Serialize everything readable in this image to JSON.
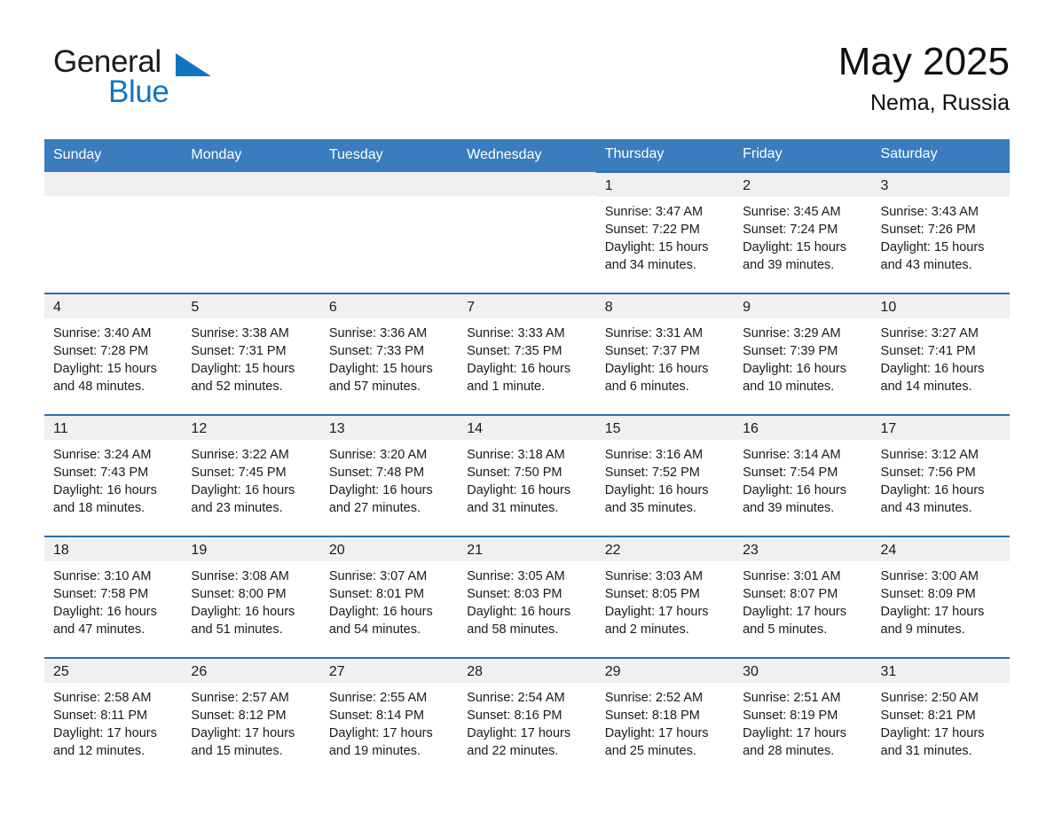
{
  "brand": {
    "word_one": "General",
    "word_two": "Blue",
    "triangle_icon": "triangle-icon"
  },
  "header": {
    "month_title": "May 2025",
    "location": "Nema, Russia"
  },
  "colors": {
    "header_blue": "#3a7cbe",
    "row_rule_blue": "#2f6fad",
    "daynum_gray": "#f0f0f0",
    "brand_blue": "#1275c1"
  },
  "weekday_headers": [
    "Sunday",
    "Monday",
    "Tuesday",
    "Wednesday",
    "Thursday",
    "Friday",
    "Saturday"
  ],
  "weeks": [
    [
      {
        "day": "",
        "sunrise": "",
        "sunset": "",
        "daylight_1": "",
        "daylight_2": ""
      },
      {
        "day": "",
        "sunrise": "",
        "sunset": "",
        "daylight_1": "",
        "daylight_2": ""
      },
      {
        "day": "",
        "sunrise": "",
        "sunset": "",
        "daylight_1": "",
        "daylight_2": ""
      },
      {
        "day": "",
        "sunrise": "",
        "sunset": "",
        "daylight_1": "",
        "daylight_2": ""
      },
      {
        "day": "1",
        "sunrise": "Sunrise: 3:47 AM",
        "sunset": "Sunset: 7:22 PM",
        "daylight_1": "Daylight: 15 hours",
        "daylight_2": "and 34 minutes."
      },
      {
        "day": "2",
        "sunrise": "Sunrise: 3:45 AM",
        "sunset": "Sunset: 7:24 PM",
        "daylight_1": "Daylight: 15 hours",
        "daylight_2": "and 39 minutes."
      },
      {
        "day": "3",
        "sunrise": "Sunrise: 3:43 AM",
        "sunset": "Sunset: 7:26 PM",
        "daylight_1": "Daylight: 15 hours",
        "daylight_2": "and 43 minutes."
      }
    ],
    [
      {
        "day": "4",
        "sunrise": "Sunrise: 3:40 AM",
        "sunset": "Sunset: 7:28 PM",
        "daylight_1": "Daylight: 15 hours",
        "daylight_2": "and 48 minutes."
      },
      {
        "day": "5",
        "sunrise": "Sunrise: 3:38 AM",
        "sunset": "Sunset: 7:31 PM",
        "daylight_1": "Daylight: 15 hours",
        "daylight_2": "and 52 minutes."
      },
      {
        "day": "6",
        "sunrise": "Sunrise: 3:36 AM",
        "sunset": "Sunset: 7:33 PM",
        "daylight_1": "Daylight: 15 hours",
        "daylight_2": "and 57 minutes."
      },
      {
        "day": "7",
        "sunrise": "Sunrise: 3:33 AM",
        "sunset": "Sunset: 7:35 PM",
        "daylight_1": "Daylight: 16 hours",
        "daylight_2": "and 1 minute."
      },
      {
        "day": "8",
        "sunrise": "Sunrise: 3:31 AM",
        "sunset": "Sunset: 7:37 PM",
        "daylight_1": "Daylight: 16 hours",
        "daylight_2": "and 6 minutes."
      },
      {
        "day": "9",
        "sunrise": "Sunrise: 3:29 AM",
        "sunset": "Sunset: 7:39 PM",
        "daylight_1": "Daylight: 16 hours",
        "daylight_2": "and 10 minutes."
      },
      {
        "day": "10",
        "sunrise": "Sunrise: 3:27 AM",
        "sunset": "Sunset: 7:41 PM",
        "daylight_1": "Daylight: 16 hours",
        "daylight_2": "and 14 minutes."
      }
    ],
    [
      {
        "day": "11",
        "sunrise": "Sunrise: 3:24 AM",
        "sunset": "Sunset: 7:43 PM",
        "daylight_1": "Daylight: 16 hours",
        "daylight_2": "and 18 minutes."
      },
      {
        "day": "12",
        "sunrise": "Sunrise: 3:22 AM",
        "sunset": "Sunset: 7:45 PM",
        "daylight_1": "Daylight: 16 hours",
        "daylight_2": "and 23 minutes."
      },
      {
        "day": "13",
        "sunrise": "Sunrise: 3:20 AM",
        "sunset": "Sunset: 7:48 PM",
        "daylight_1": "Daylight: 16 hours",
        "daylight_2": "and 27 minutes."
      },
      {
        "day": "14",
        "sunrise": "Sunrise: 3:18 AM",
        "sunset": "Sunset: 7:50 PM",
        "daylight_1": "Daylight: 16 hours",
        "daylight_2": "and 31 minutes."
      },
      {
        "day": "15",
        "sunrise": "Sunrise: 3:16 AM",
        "sunset": "Sunset: 7:52 PM",
        "daylight_1": "Daylight: 16 hours",
        "daylight_2": "and 35 minutes."
      },
      {
        "day": "16",
        "sunrise": "Sunrise: 3:14 AM",
        "sunset": "Sunset: 7:54 PM",
        "daylight_1": "Daylight: 16 hours",
        "daylight_2": "and 39 minutes."
      },
      {
        "day": "17",
        "sunrise": "Sunrise: 3:12 AM",
        "sunset": "Sunset: 7:56 PM",
        "daylight_1": "Daylight: 16 hours",
        "daylight_2": "and 43 minutes."
      }
    ],
    [
      {
        "day": "18",
        "sunrise": "Sunrise: 3:10 AM",
        "sunset": "Sunset: 7:58 PM",
        "daylight_1": "Daylight: 16 hours",
        "daylight_2": "and 47 minutes."
      },
      {
        "day": "19",
        "sunrise": "Sunrise: 3:08 AM",
        "sunset": "Sunset: 8:00 PM",
        "daylight_1": "Daylight: 16 hours",
        "daylight_2": "and 51 minutes."
      },
      {
        "day": "20",
        "sunrise": "Sunrise: 3:07 AM",
        "sunset": "Sunset: 8:01 PM",
        "daylight_1": "Daylight: 16 hours",
        "daylight_2": "and 54 minutes."
      },
      {
        "day": "21",
        "sunrise": "Sunrise: 3:05 AM",
        "sunset": "Sunset: 8:03 PM",
        "daylight_1": "Daylight: 16 hours",
        "daylight_2": "and 58 minutes."
      },
      {
        "day": "22",
        "sunrise": "Sunrise: 3:03 AM",
        "sunset": "Sunset: 8:05 PM",
        "daylight_1": "Daylight: 17 hours",
        "daylight_2": "and 2 minutes."
      },
      {
        "day": "23",
        "sunrise": "Sunrise: 3:01 AM",
        "sunset": "Sunset: 8:07 PM",
        "daylight_1": "Daylight: 17 hours",
        "daylight_2": "and 5 minutes."
      },
      {
        "day": "24",
        "sunrise": "Sunrise: 3:00 AM",
        "sunset": "Sunset: 8:09 PM",
        "daylight_1": "Daylight: 17 hours",
        "daylight_2": "and 9 minutes."
      }
    ],
    [
      {
        "day": "25",
        "sunrise": "Sunrise: 2:58 AM",
        "sunset": "Sunset: 8:11 PM",
        "daylight_1": "Daylight: 17 hours",
        "daylight_2": "and 12 minutes."
      },
      {
        "day": "26",
        "sunrise": "Sunrise: 2:57 AM",
        "sunset": "Sunset: 8:12 PM",
        "daylight_1": "Daylight: 17 hours",
        "daylight_2": "and 15 minutes."
      },
      {
        "day": "27",
        "sunrise": "Sunrise: 2:55 AM",
        "sunset": "Sunset: 8:14 PM",
        "daylight_1": "Daylight: 17 hours",
        "daylight_2": "and 19 minutes."
      },
      {
        "day": "28",
        "sunrise": "Sunrise: 2:54 AM",
        "sunset": "Sunset: 8:16 PM",
        "daylight_1": "Daylight: 17 hours",
        "daylight_2": "and 22 minutes."
      },
      {
        "day": "29",
        "sunrise": "Sunrise: 2:52 AM",
        "sunset": "Sunset: 8:18 PM",
        "daylight_1": "Daylight: 17 hours",
        "daylight_2": "and 25 minutes."
      },
      {
        "day": "30",
        "sunrise": "Sunrise: 2:51 AM",
        "sunset": "Sunset: 8:19 PM",
        "daylight_1": "Daylight: 17 hours",
        "daylight_2": "and 28 minutes."
      },
      {
        "day": "31",
        "sunrise": "Sunrise: 2:50 AM",
        "sunset": "Sunset: 8:21 PM",
        "daylight_1": "Daylight: 17 hours",
        "daylight_2": "and 31 minutes."
      }
    ]
  ]
}
